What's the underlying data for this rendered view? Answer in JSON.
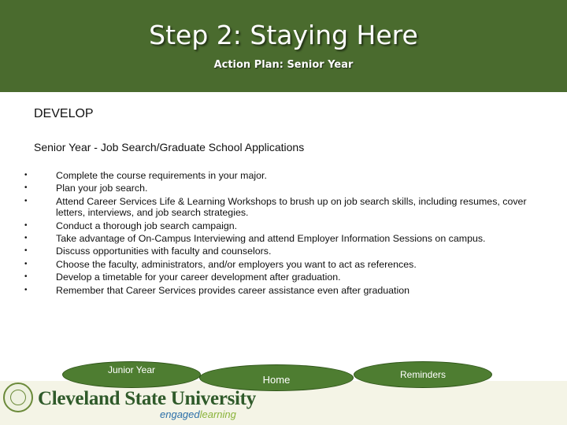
{
  "header": {
    "title": "Step 2: Staying Here",
    "subtitle": "Action Plan: Senior Year"
  },
  "content": {
    "heading": "DEVELOP",
    "subheading": "Senior Year  - Job Search/Graduate School Applications",
    "bullets": [
      "Complete the course requirements in your major.",
      "Plan your job search.",
      "Attend Career Services Life & Learning Workshops to brush up on job search skills, including resumes, cover letters, interviews, and job search strategies.",
      "Conduct a thorough job search campaign.",
      "Take advantage of On-Campus Interviewing and attend Employer Information Sessions on campus.",
      "Discuss opportunities with faculty and counselors.",
      "Choose the faculty, administrators, and/or employers you want to act as references.",
      "Develop a timetable for your career development after graduation.",
      "Remember that Career Services provides career assistance even after graduation"
    ]
  },
  "nav": {
    "junior": "Junior Year",
    "home": "Home",
    "reminders": "Reminders"
  },
  "footer": {
    "university": "Cleveland State University",
    "tagline_part1": "engaged",
    "tagline_part2": "learning"
  },
  "colors": {
    "header_bg": "#4a6b2e",
    "button_bg": "#4e7d31",
    "logo_green": "#2f5a2a",
    "tagline_blue": "#2b6fa8"
  }
}
